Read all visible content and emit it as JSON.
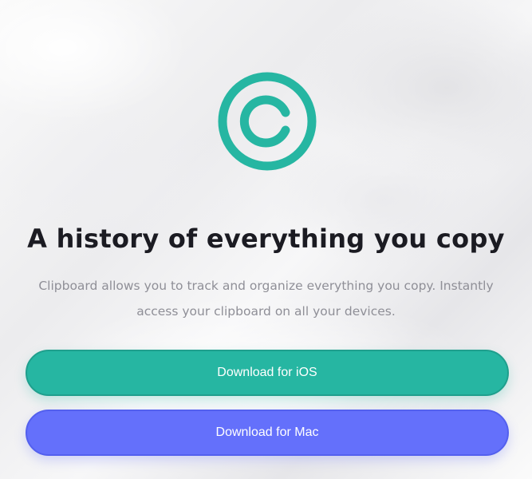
{
  "hero": {
    "logo_icon": "copyright-c-icon",
    "title": "A history of everything you copy",
    "description": "Clipboard allows you to track and organize everything you copy. Instantly access your clipboard on all your devices."
  },
  "buttons": {
    "ios_label": "Download for iOS",
    "mac_label": "Download for Mac"
  },
  "colors": {
    "accent_teal": "#26b6a2",
    "accent_blue": "#6470fb",
    "title": "#1b1b22",
    "muted_text": "#8f8f97"
  }
}
